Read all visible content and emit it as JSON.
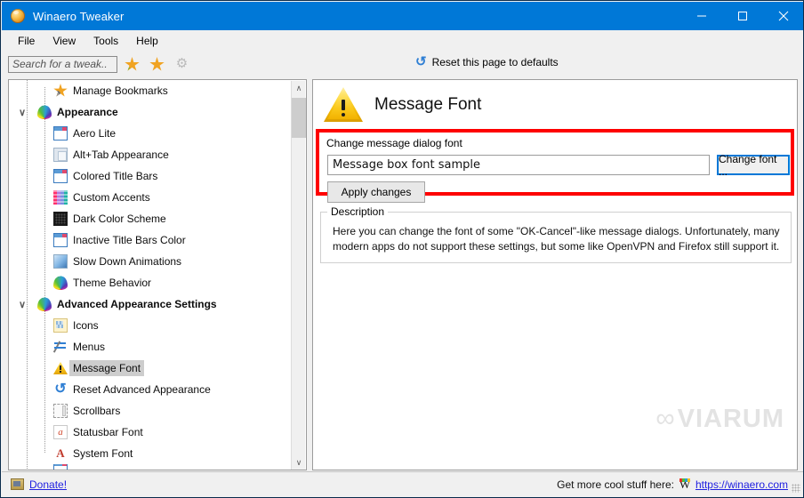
{
  "window": {
    "title": "Winaero Tweaker",
    "app_icon": "winaero-logo-icon",
    "minimize_label": "Minimize",
    "maximize_label": "Maximize",
    "close_label": "Close"
  },
  "menubar": {
    "items": [
      {
        "label": "File"
      },
      {
        "label": "View"
      },
      {
        "label": "Tools"
      },
      {
        "label": "Help"
      }
    ]
  },
  "toolbar": {
    "search_placeholder": "Search for a tweak..",
    "search_value": "",
    "favorite_add_label": "Add to favorites",
    "favorites_label": "Favorites",
    "settings_label": "Settings",
    "reset_label": "Reset this page to defaults"
  },
  "tree": {
    "items": [
      {
        "label": "Manage Bookmarks",
        "icon": "bookmark-star-icon",
        "level": 2,
        "expander": "",
        "selected": false,
        "group": false
      },
      {
        "label": "Appearance",
        "icon": "theme-palette-icon",
        "level": 1,
        "expander": "v",
        "selected": false,
        "group": true
      },
      {
        "label": "Aero Lite",
        "icon": "window-icon",
        "level": 2,
        "expander": "",
        "selected": false,
        "group": false
      },
      {
        "label": "Alt+Tab Appearance",
        "icon": "alt-tab-icon",
        "level": 2,
        "expander": "",
        "selected": false,
        "group": false
      },
      {
        "label": "Colored Title Bars",
        "icon": "window-icon",
        "level": 2,
        "expander": "",
        "selected": false,
        "group": false
      },
      {
        "label": "Custom Accents",
        "icon": "color-swatches-icon",
        "level": 2,
        "expander": "",
        "selected": false,
        "group": false
      },
      {
        "label": "Dark Color Scheme",
        "icon": "dark-scheme-icon",
        "level": 2,
        "expander": "",
        "selected": false,
        "group": false
      },
      {
        "label": "Inactive Title Bars Color",
        "icon": "window-icon",
        "level": 2,
        "expander": "",
        "selected": false,
        "group": false
      },
      {
        "label": "Slow Down Animations",
        "icon": "monitor-icon",
        "level": 2,
        "expander": "",
        "selected": false,
        "group": false
      },
      {
        "label": "Theme Behavior",
        "icon": "theme-palette-icon",
        "level": 2,
        "expander": "",
        "selected": false,
        "group": false
      },
      {
        "label": "Advanced Appearance Settings",
        "icon": "theme-palette-icon",
        "level": 1,
        "expander": "v",
        "selected": false,
        "group": true
      },
      {
        "label": "Icons",
        "icon": "icons-page-icon",
        "level": 2,
        "expander": "",
        "selected": false,
        "group": false
      },
      {
        "label": "Menus",
        "icon": "menus-icon",
        "level": 2,
        "expander": "",
        "selected": false,
        "group": false
      },
      {
        "label": "Message Font",
        "icon": "warning-triangle-icon",
        "level": 2,
        "expander": "",
        "selected": true,
        "group": false
      },
      {
        "label": "Reset Advanced Appearance",
        "icon": "reset-arrow-icon",
        "level": 2,
        "expander": "",
        "selected": false,
        "group": false
      },
      {
        "label": "Scrollbars",
        "icon": "scrollbar-icon",
        "level": 2,
        "expander": "",
        "selected": false,
        "group": false
      },
      {
        "label": "Statusbar Font",
        "icon": "lowercase-a-icon",
        "level": 2,
        "expander": "",
        "selected": false,
        "group": false
      },
      {
        "label": "System Font",
        "icon": "uppercase-a-icon",
        "level": 2,
        "expander": "",
        "selected": false,
        "group": false
      }
    ],
    "scrollbar": {
      "up_arrow": "∧",
      "down_arrow": "∨"
    }
  },
  "page": {
    "title": "Message Font",
    "header_icon": "warning-triangle-icon",
    "group_label": "Change message dialog font",
    "font_sample_value": "Message box font sample",
    "change_font_button": "Change font ...",
    "apply_button": "Apply changes",
    "description_legend": "Description",
    "description_text": "Here you can change the font of some \"OK-Cancel\"-like message dialogs. Unfortunately, many modern apps do not support these settings, but some like OpenVPN and Firefox still support it.",
    "highlight_color": "#fe0000",
    "focus_color": "#0078d7"
  },
  "watermark": {
    "mark": "∞",
    "text": "VIARUM"
  },
  "statusbar": {
    "donate_label": "Donate!",
    "donate_icon": "money-icon",
    "more_stuff_label": "Get more cool stuff here:",
    "site_icon": "winaero-w-icon",
    "site_url": "https://winaero.com"
  }
}
